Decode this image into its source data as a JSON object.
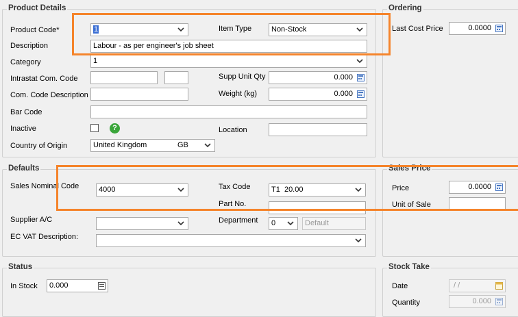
{
  "product_details": {
    "title": "Product Details",
    "product_code": {
      "label": "Product Code*",
      "value": "1"
    },
    "item_type": {
      "label": "Item Type",
      "value": "Non-Stock"
    },
    "description": {
      "label": "Description",
      "value": "Labour - as per engineer's job sheet"
    },
    "category": {
      "label": "Category",
      "value": "1"
    },
    "intrastat": {
      "label": "Intrastat Com. Code"
    },
    "supp_unit_qty": {
      "label": "Supp Unit Qty",
      "value": "0.000"
    },
    "com_code_desc": {
      "label": "Com. Code Description"
    },
    "weight": {
      "label": "Weight (kg)",
      "value": "0.000"
    },
    "bar_code": {
      "label": "Bar Code"
    },
    "inactive": {
      "label": "Inactive"
    },
    "location": {
      "label": "Location"
    },
    "country": {
      "label": "Country of Origin",
      "value": "United Kingdom",
      "code": "GB"
    }
  },
  "ordering": {
    "title": "Ordering",
    "last_cost_price": {
      "label": "Last Cost Price",
      "value": "0.0000"
    }
  },
  "defaults": {
    "title": "Defaults",
    "sales_nominal": {
      "label": "Sales Nominal Code",
      "value": "4000"
    },
    "tax_code": {
      "label": "Tax Code",
      "value": "T1  20.00"
    },
    "part_no": {
      "label": "Part No."
    },
    "supplier": {
      "label": "Supplier A/C"
    },
    "department": {
      "label": "Department",
      "value": "0",
      "placeholder": "Default"
    },
    "ec_vat": {
      "label": "EC VAT Description:"
    }
  },
  "sales_price": {
    "title": "Sales Price",
    "price": {
      "label": "Price",
      "value": "0.0000"
    },
    "unit_of_sale": {
      "label": "Unit of Sale"
    }
  },
  "status": {
    "title": "Status",
    "in_stock": {
      "label": "In Stock",
      "value": "0.000"
    }
  },
  "stock_take": {
    "title": "Stock Take",
    "date": {
      "label": "Date",
      "value": " / /"
    },
    "quantity": {
      "label": "Quantity",
      "value": "0.000"
    }
  },
  "colors": {
    "highlight": "#f5842b",
    "help": "#3aa53a",
    "selection": "#3b6fd4"
  }
}
